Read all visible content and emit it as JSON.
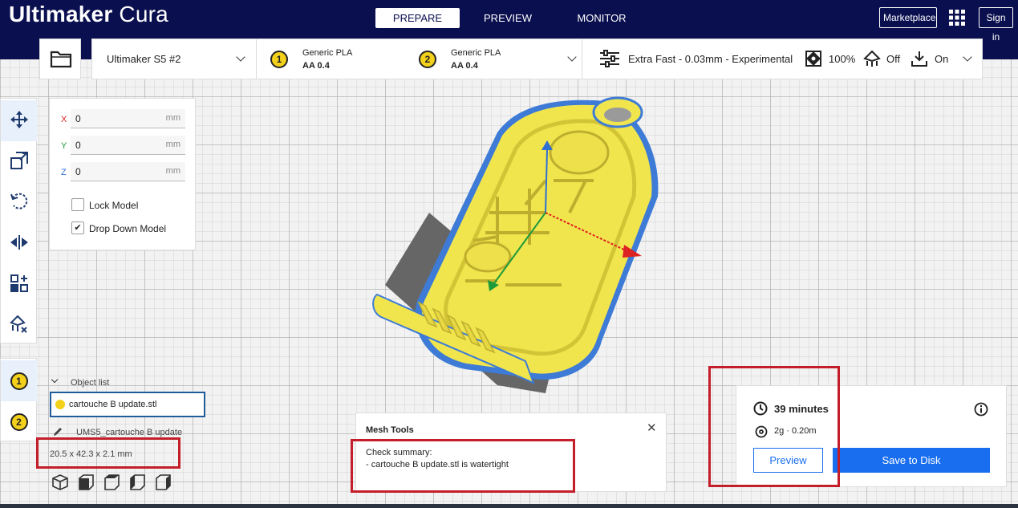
{
  "app": {
    "title_bold": "Ultimaker",
    "title_light": "Cura"
  },
  "stages": [
    "PREPARE",
    "PREVIEW",
    "MONITOR"
  ],
  "header": {
    "marketplace_label": "Marketplace",
    "signin_label": "Sign in"
  },
  "printer": {
    "name": "Ultimaker S5 #2"
  },
  "extruders": [
    {
      "number": "1",
      "material": "Generic PLA",
      "nozzle": "AA 0.4"
    },
    {
      "number": "2",
      "material": "Generic PLA",
      "nozzle": "AA 0.4"
    }
  ],
  "print_settings": {
    "profile": "Extra Fast - 0.03mm - Experimental",
    "infill": "100%",
    "support": "Off",
    "adhesion": "On"
  },
  "move_panel": {
    "x_label": "X",
    "y_label": "Y",
    "z_label": "Z",
    "x_value": "0",
    "y_value": "0",
    "z_value": "0",
    "unit": "mm",
    "lock_model_label": "Lock Model",
    "drop_down_label": "Drop Down Model"
  },
  "ext_buttons": [
    "1",
    "2"
  ],
  "object_list": {
    "header": "Object list",
    "selected_object": "cartouche B update.stl",
    "job_name": "UMS5_cartouche B update",
    "dimensions": "20.5 x 42.3 x 2.1 mm"
  },
  "mesh_tools": {
    "title": "Mesh Tools",
    "summary_title": "Check summary:",
    "summary_line": "- cartouche B update.stl is watertight"
  },
  "print_info": {
    "time": "39 minutes",
    "material": "2g · 0.20m",
    "preview_label": "Preview",
    "save_label": "Save to Disk"
  },
  "colors": {
    "header_bg": "#0a0f4f",
    "accent": "#196ef0",
    "model_yellow": "#f5ec5b",
    "highlight_red": "#c41e2a"
  },
  "icons": [
    "folder-icon",
    "move-icon",
    "scale-icon",
    "rotate-icon",
    "mirror-icon",
    "per-model-settings-icon",
    "support-blocker-icon",
    "apps-grid-icon",
    "settings-sliders-icon",
    "infill-icon",
    "support-icon",
    "adhesion-icon",
    "clock-icon",
    "spool-icon",
    "info-icon",
    "close-icon",
    "pencil-icon"
  ]
}
